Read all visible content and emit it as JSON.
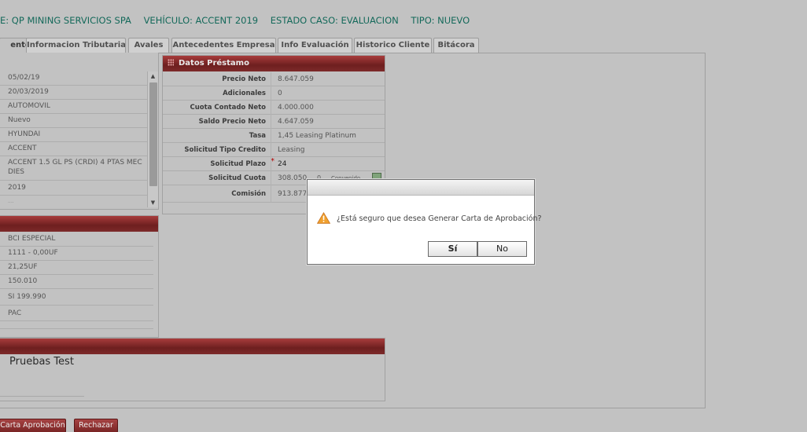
{
  "header": {
    "client": "E: QP MINING SERVICIOS SPA",
    "vehicle": "VEHÍCULO: ACCENT 2019",
    "state": "ESTADO CASO: EVALUACION",
    "type": "TIPO: NUEVO"
  },
  "tabs": [
    "ento",
    "Informacion Tributaria",
    "Avales",
    "Antecedentes Empresa",
    "Info Evaluación",
    "Historico Cliente",
    "Bitácora"
  ],
  "vehicle_list": [
    "05/02/19",
    "20/03/2019",
    "AUTOMOVIL",
    "Nuevo",
    "HYUNDAI",
    "ACCENT",
    "ACCENT 1.5 GL PS (CRDI) 4 PTAS MEC DIES",
    "2019",
    "...."
  ],
  "second_list": [
    "BCI ESPECIAL",
    "1111  -  0,00UF",
    "21,25UF",
    "150.010",
    "SI     199.990",
    "PAC"
  ],
  "loan": {
    "title": "Datos Préstamo",
    "rows": [
      {
        "label": "Precio Neto",
        "value": "8.647.059"
      },
      {
        "label": "Adicionales",
        "value": "0"
      },
      {
        "label": "Cuota Contado Neto",
        "value": "4.000.000"
      },
      {
        "label": "Saldo Precio Neto",
        "value": "4.647.059"
      },
      {
        "label": "Tasa",
        "value": "1,45  Leasing Platinum"
      },
      {
        "label": "Solicitud Tipo Credito",
        "value": "Leasing"
      },
      {
        "label": "Solicitud Plazo",
        "value": "24"
      },
      {
        "label": "Solicitud Cuota",
        "value": "308.050"
      },
      {
        "label": "Comisión",
        "value": "913.877"
      }
    ],
    "cuota_extra": "0",
    "cuota_extra_label": "Convenido"
  },
  "comment": {
    "text": "Pruebas Test"
  },
  "buttons": {
    "generate": "Carta Aprobación",
    "reject": "Rechazar"
  },
  "dialog": {
    "message": "¿Está seguro que desea Generar Carta de Aprobación?",
    "yes": "Sí",
    "no": "No"
  }
}
